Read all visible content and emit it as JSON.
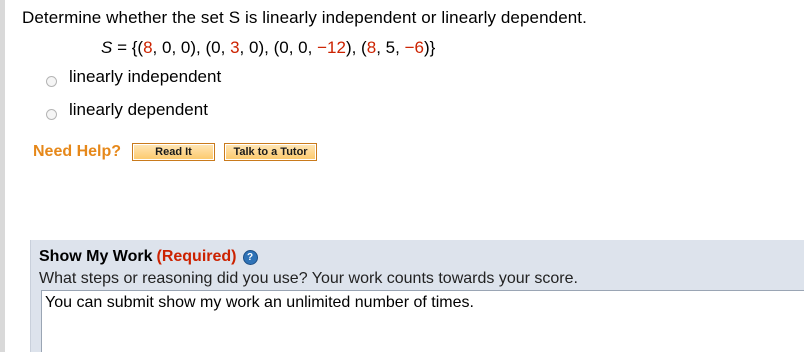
{
  "question": {
    "text": "Determine whether the set S is linearly independent or linearly dependent."
  },
  "set_expression": {
    "lhs": "S",
    "equals": " = {(",
    "v1": [
      "8",
      "0",
      "0"
    ],
    "v2": [
      "0",
      "3",
      "0"
    ],
    "v3": [
      "0",
      "0",
      "−12"
    ],
    "v4": [
      "8",
      "5",
      "−6"
    ]
  },
  "options": [
    {
      "label": "linearly independent",
      "selected": false
    },
    {
      "label": "linearly dependent",
      "selected": false
    }
  ],
  "help": {
    "need_help": "Need Help?",
    "read_it": "Read It",
    "talk_to_tutor": "Talk to a Tutor"
  },
  "show_my_work": {
    "title": "Show My Work",
    "required": "(Required)",
    "help_icon_glyph": "?",
    "subtitle": "What steps or reasoning did you use? Your work counts towards your score.",
    "box_text": "You can submit show my work an unlimited number of times."
  },
  "colors": {
    "value_red": "#cc2200",
    "need_help_orange": "#e6881a",
    "button_fill": "#fcc86a",
    "panel_bg": "#dde3ec"
  }
}
